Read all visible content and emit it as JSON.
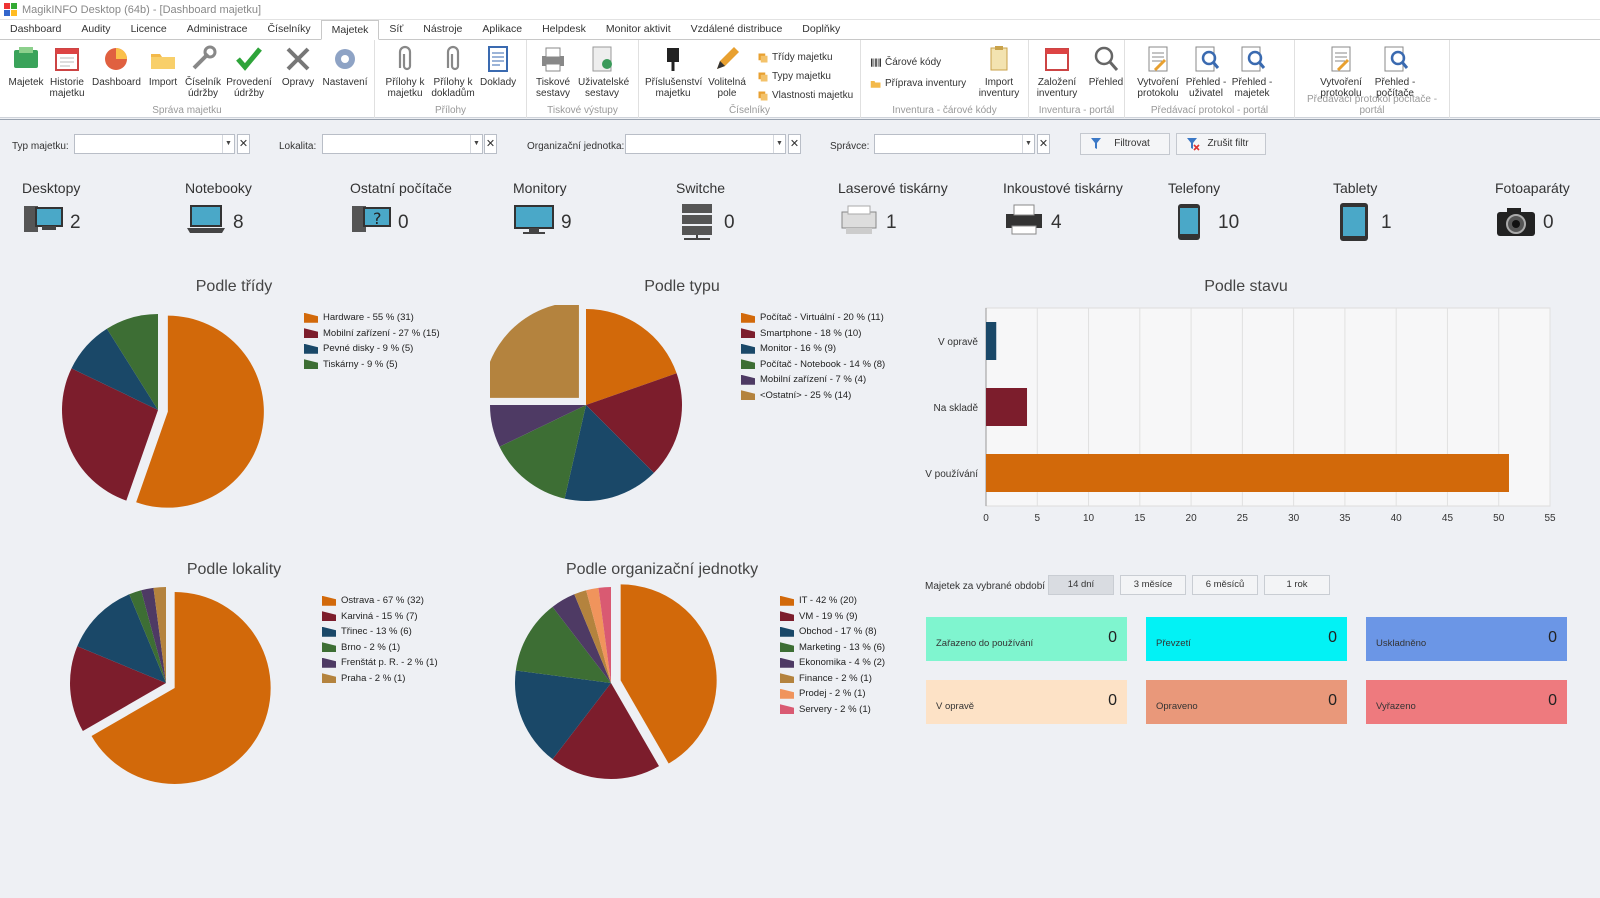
{
  "window": {
    "title": "MagikINFO Desktop (64b) - [Dashboard majetku]"
  },
  "menu": {
    "tabs": [
      "Dashboard",
      "Audity",
      "Licence",
      "Administrace",
      "Číselníky",
      "Majetek",
      "Síť",
      "Nástroje",
      "Aplikace",
      "Helpdesk",
      "Monitor aktivit",
      "Vzdálené distribuce",
      "Doplňky"
    ],
    "active": "Majetek"
  },
  "ribbon": {
    "groups": {
      "sprava": "Správa majetku",
      "prilohy": "Přílohy",
      "tisk": "Tiskové výstupy",
      "ciselniky": "Číselníky",
      "inventura": "Inventura - čárové kódy",
      "inventura_portal": "Inventura - portál",
      "predavaci": "Předávací protokol - portál",
      "predavaci_pc": "Předávací protokol počítače - portál"
    },
    "buttons": {
      "majetek": "Majetek",
      "historie": "Historie majetku",
      "dashboard": "Dashboard",
      "import": "Import",
      "ciselnik_udrzby": "Číselník údržby",
      "provedeni_udrzby": "Provedení údržby",
      "opravy": "Opravy",
      "nastaveni": "Nastavení",
      "prilohy_majetku": "Přílohy k majetku",
      "prilohy_dokladum": "Přílohy k dokladům",
      "doklady": "Doklady",
      "tiskove_sestavy": "Tiskové sestavy",
      "uzivatelske_sestavy": "Uživatelské sestavy",
      "prislusenstvi": "Příslušenství majetku",
      "volitelna_pole": "Volitelná pole",
      "tridy": "Třídy majetku",
      "typy": "Typy majetku",
      "vlastnosti": "Vlastnosti majetku",
      "carove_kody": "Čárové kódy",
      "priprava_inventury": "Příprava inventury",
      "import_inventury": "Import inventury",
      "zalozeni_inventury": "Založení inventury",
      "prehled": "Přehled",
      "vytvoreni_protokolu": "Vytvoření protokolu",
      "prehled_uzivatel": "Přehled - uživatel",
      "prehled_majetek": "Přehled - majetek",
      "vytvoreni_protokolu2": "Vytvoření protokolu",
      "prehled_pocitace": "Přehled - počítače"
    }
  },
  "filters": {
    "typ": "Typ majetku:",
    "lokalita": "Lokalita:",
    "org": "Organizační jednotka:",
    "spravce": "Správce:",
    "filtrovat": "Filtrovat",
    "zrusit": "Zrušit filtr"
  },
  "stats": [
    {
      "label": "Desktopy",
      "value": "2",
      "icon": "desktop-icon"
    },
    {
      "label": "Notebooky",
      "value": "8",
      "icon": "notebook-icon"
    },
    {
      "label": "Ostatní počítače",
      "value": "0",
      "icon": "other-computer-icon"
    },
    {
      "label": "Monitory",
      "value": "9",
      "icon": "monitor-icon"
    },
    {
      "label": "Switche",
      "value": "0",
      "icon": "switch-icon"
    },
    {
      "label": "Laserové tiskárny",
      "value": "1",
      "icon": "laser-printer-icon"
    },
    {
      "label": "Inkoustové tiskárny",
      "value": "4",
      "icon": "inkjet-printer-icon"
    },
    {
      "label": "Telefony",
      "value": "10",
      "icon": "phone-icon"
    },
    {
      "label": "Tablety",
      "value": "1",
      "icon": "tablet-icon"
    },
    {
      "label": "Fotoaparáty",
      "value": "0",
      "icon": "camera-icon"
    }
  ],
  "colors": {
    "orange": "#d2690a",
    "red": "#7c1d2c",
    "blue": "#1a4868",
    "green": "#3d6e34",
    "purple": "#4e3a64",
    "tan": "#b4833e",
    "salmon": "#f0945c",
    "pink": "#d95a72"
  },
  "chart_data": [
    {
      "type": "pie",
      "title": "Podle třídy",
      "slices": [
        {
          "label": "Hardware - 55 % (31)",
          "value": 31,
          "color": "orange"
        },
        {
          "label": "Mobilní zařízení - 27 % (15)",
          "value": 15,
          "color": "red"
        },
        {
          "label": "Pevné disky - 9 % (5)",
          "value": 5,
          "color": "blue"
        },
        {
          "label": "Tiskárny - 9 % (5)",
          "value": 5,
          "color": "green"
        }
      ]
    },
    {
      "type": "pie",
      "title": "Podle typu",
      "slices": [
        {
          "label": "Počítač - Virtuální - 20 % (11)",
          "value": 11,
          "color": "orange"
        },
        {
          "label": "Smartphone - 18 % (10)",
          "value": 10,
          "color": "red"
        },
        {
          "label": "Monitor - 16 % (9)",
          "value": 9,
          "color": "blue"
        },
        {
          "label": "Počítač - Notebook - 14 % (8)",
          "value": 8,
          "color": "green"
        },
        {
          "label": "Mobilní zařízení - 7 % (4)",
          "value": 4,
          "color": "purple"
        },
        {
          "label": "<Ostatní> - 25 % (14)",
          "value": 14,
          "color": "tan"
        }
      ]
    },
    {
      "type": "bar",
      "title": "Podle stavu",
      "categories": [
        "V opravě",
        "Na skladě",
        "V používání"
      ],
      "values": [
        1,
        4,
        51
      ],
      "colors": [
        "blue",
        "red",
        "orange"
      ],
      "xlim": [
        0,
        55
      ],
      "ticks": [
        0,
        5,
        10,
        15,
        20,
        25,
        30,
        35,
        40,
        45,
        50,
        55
      ]
    },
    {
      "type": "pie",
      "title": "Podle lokality",
      "slices": [
        {
          "label": "Ostrava - 67 % (32)",
          "value": 32,
          "color": "orange"
        },
        {
          "label": "Karviná - 15 % (7)",
          "value": 7,
          "color": "red"
        },
        {
          "label": "Třinec - 13 % (6)",
          "value": 6,
          "color": "blue"
        },
        {
          "label": "Brno - 2 % (1)",
          "value": 1,
          "color": "green"
        },
        {
          "label": "Frenštát p. R. - 2 % (1)",
          "value": 1,
          "color": "purple"
        },
        {
          "label": "Praha - 2 % (1)",
          "value": 1,
          "color": "tan"
        }
      ]
    },
    {
      "type": "pie",
      "title": "Podle organizační jednotky",
      "slices": [
        {
          "label": "IT - 42 % (20)",
          "value": 20,
          "color": "orange"
        },
        {
          "label": "VM - 19 % (9)",
          "value": 9,
          "color": "red"
        },
        {
          "label": "Obchod - 17 % (8)",
          "value": 8,
          "color": "blue"
        },
        {
          "label": "Marketing - 13 % (6)",
          "value": 6,
          "color": "green"
        },
        {
          "label": "Ekonomika - 4 % (2)",
          "value": 2,
          "color": "purple"
        },
        {
          "label": "Finance - 2 % (1)",
          "value": 1,
          "color": "tan"
        },
        {
          "label": "Prodej - 2 % (1)",
          "value": 1,
          "color": "salmon"
        },
        {
          "label": "Servery - 2 % (1)",
          "value": 1,
          "color": "pink"
        }
      ]
    }
  ],
  "period": {
    "label": "Majetek za vybrané období",
    "options": [
      "14 dní",
      "3 měsíce",
      "6 měsíců",
      "1 rok"
    ],
    "selected": "14 dní"
  },
  "tiles": [
    {
      "label": "Zařazeno do používání",
      "value": "0",
      "color": "#7ff5cf"
    },
    {
      "label": "Převzetí",
      "value": "0",
      "color": "#02f2f5"
    },
    {
      "label": "Uskladněno",
      "value": "0",
      "color": "#6b96e6"
    },
    {
      "label": "V opravě",
      "value": "0",
      "color": "#fde2c6"
    },
    {
      "label": "Opraveno",
      "value": "0",
      "color": "#e9987a"
    },
    {
      "label": "Vyřazeno",
      "value": "0",
      "color": "#ee7a7e"
    }
  ]
}
